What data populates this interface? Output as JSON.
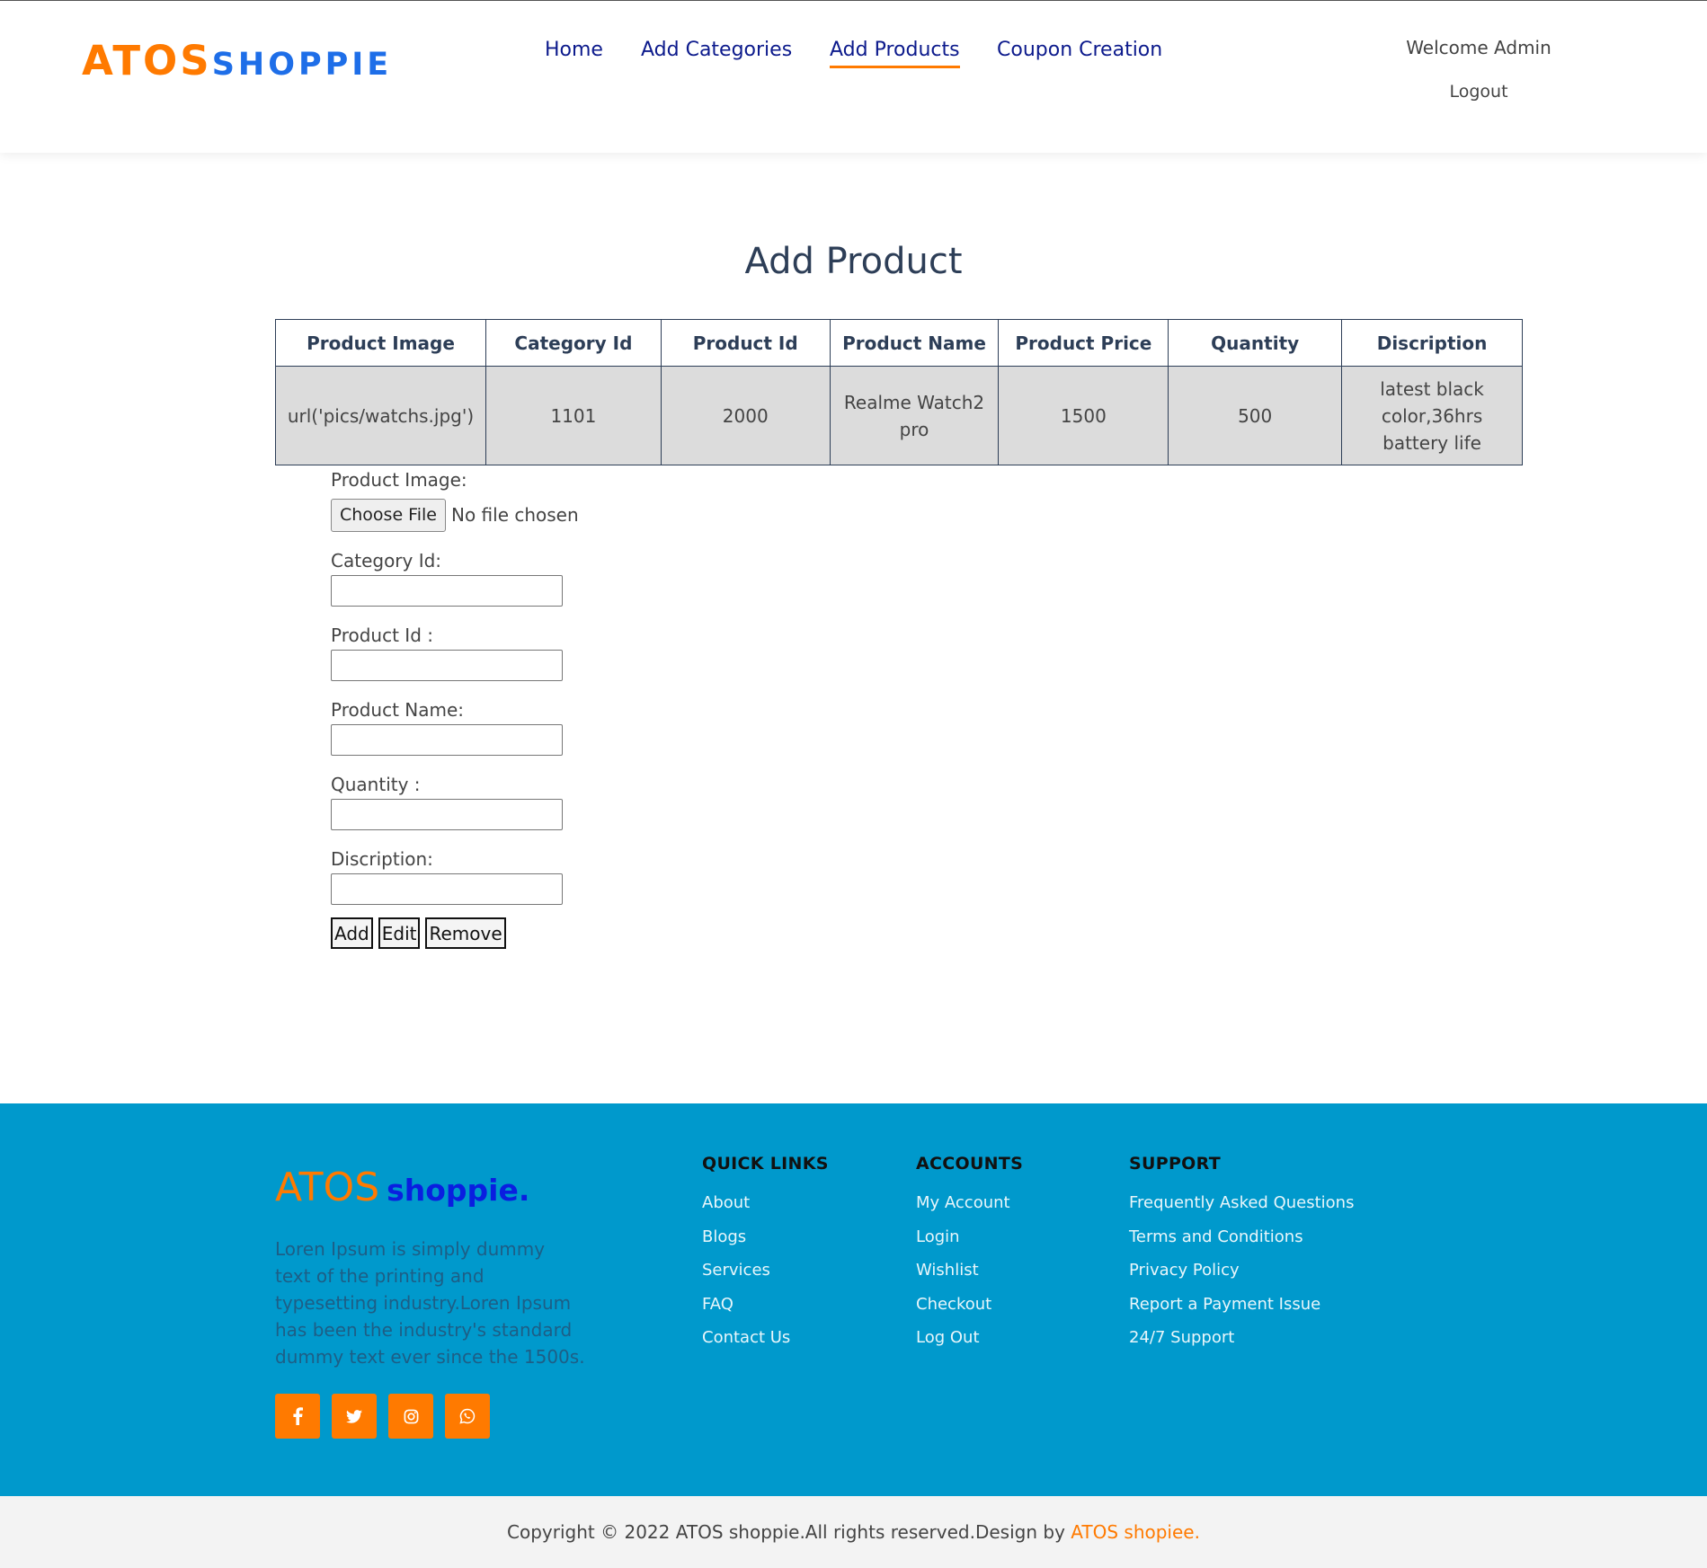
{
  "header": {
    "logo_part1": "ATOS",
    "logo_part2": "SHOPPIE",
    "nav": [
      "Home",
      "Add Categories",
      "Add Products",
      "Coupon Creation"
    ],
    "active_nav": "Add Products",
    "welcome": "Welcome Admin",
    "logout": "Logout"
  },
  "main": {
    "title": "Add Product",
    "table": {
      "headers": [
        "Product Image",
        "Category Id",
        "Product Id",
        "Product Name",
        "Product Price",
        "Quantity",
        "Discription"
      ],
      "rows": [
        [
          "url('pics/watchs.jpg')",
          "1101",
          "2000",
          "Realme Watch2 pro",
          "1500",
          "500",
          "latest black color,36hrs battery life"
        ]
      ]
    },
    "form": {
      "product_image_label": "Product Image:",
      "choose_file": "Choose File",
      "no_file": "No file chosen",
      "category_id_label": "Category Id:",
      "product_id_label": "Product Id :",
      "product_name_label": "Product Name:",
      "quantity_label": "Quantity :",
      "description_label": "Discription:",
      "add": "Add",
      "edit": "Edit",
      "remove": "Remove"
    }
  },
  "footer": {
    "logo_part1": "ATOS",
    "logo_part2": "shoppie.",
    "description": "Loren Ipsum is simply dummy text of the printing and typesetting industry.Loren Ipsum has been the industry's standard dummy text ever since the 1500s.",
    "socials": [
      "facebook-icon",
      "twitter-icon",
      "instagram-icon",
      "whatsapp-icon"
    ],
    "quick_links": {
      "title": "QUICK LINKS",
      "items": [
        "About",
        "Blogs",
        "Services",
        "FAQ",
        "Contact Us"
      ]
    },
    "accounts": {
      "title": "ACCOUNTS",
      "items": [
        "My Account",
        "Login",
        "Wishlist",
        "Checkout",
        "Log Out"
      ]
    },
    "support": {
      "title": "SUPPORT",
      "items": [
        "Frequently Asked Questions",
        "Terms and Conditions",
        "Privacy Policy",
        "Report a Payment Issue",
        "24/7 Support"
      ]
    },
    "copyright": "Copyright © 2022 ATOS shoppie.All rights reserved.Design by",
    "designer": "ATOS shopiee."
  },
  "colors": {
    "accent": "#ff7a00",
    "brand_blue": "#1e6ee8",
    "nav": "#0c1a8c",
    "footer_bg": "#0099cc"
  }
}
